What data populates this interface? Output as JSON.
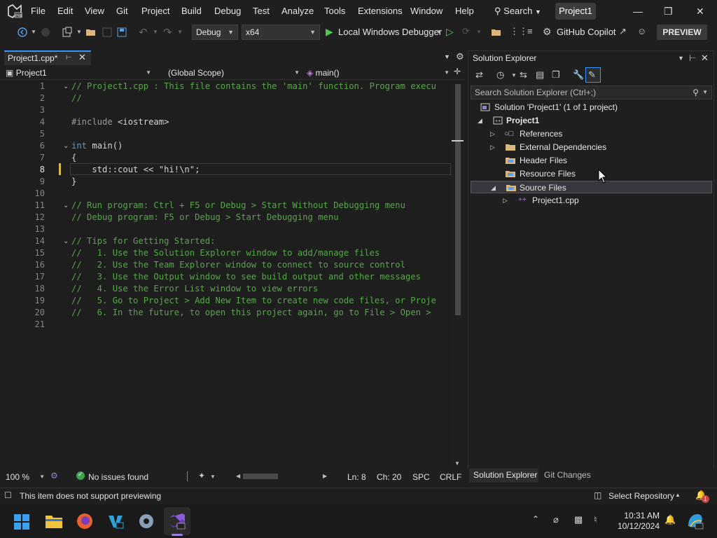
{
  "menu": {
    "items": [
      "File",
      "Edit",
      "View",
      "Git",
      "Project",
      "Build",
      "Debug",
      "Test",
      "Analyze",
      "Tools",
      "Extensions",
      "Window",
      "Help"
    ],
    "search_label": "Search",
    "project_badge": "Project1"
  },
  "toolbar": {
    "config": "Debug",
    "platform": "x64",
    "run_label": "Local Windows Debugger",
    "copilot_label": "GitHub Copilot",
    "preview_label": "PREVIEW"
  },
  "editor": {
    "tab_label": "Project1.cpp*",
    "nav": {
      "project": "Project1",
      "scope": "(Global Scope)",
      "member": "main()"
    },
    "current_line": 8,
    "lines": [
      {
        "n": "1",
        "text": "// Project1.cpp : This file contains the 'main' function. Program execu"
      },
      {
        "n": "2",
        "text": "//"
      },
      {
        "n": "3",
        "text": ""
      },
      {
        "n": "4",
        "pre": "#include ",
        "text": "<iostream>"
      },
      {
        "n": "5",
        "text": ""
      },
      {
        "n": "6",
        "pre": "int ",
        "text": "main()"
      },
      {
        "n": "7",
        "text": "{"
      },
      {
        "n": "8",
        "text": "    std::cout << \"hi!\\n\";"
      },
      {
        "n": "9",
        "text": "}"
      },
      {
        "n": "10",
        "text": ""
      },
      {
        "n": "11",
        "text": "// Run program: Ctrl + F5 or Debug > Start Without Debugging menu"
      },
      {
        "n": "12",
        "text": "// Debug program: F5 or Debug > Start Debugging menu"
      },
      {
        "n": "13",
        "text": ""
      },
      {
        "n": "14",
        "text": "// Tips for Getting Started:"
      },
      {
        "n": "15",
        "text": "//   1. Use the Solution Explorer window to add/manage files"
      },
      {
        "n": "16",
        "text": "//   2. Use the Team Explorer window to connect to source control"
      },
      {
        "n": "17",
        "text": "//   3. Use the Output window to see build output and other messages"
      },
      {
        "n": "18",
        "text": "//   4. Use the Error List window to view errors"
      },
      {
        "n": "19",
        "text": "//   5. Go to Project > Add New Item to create new code files, or Proje"
      },
      {
        "n": "20",
        "text": "//   6. In the future, to open this project again, go to File > Open >"
      },
      {
        "n": "21",
        "text": ""
      }
    ],
    "status": {
      "zoom": "100 %",
      "issues": "No issues found",
      "ln": "Ln: 8",
      "ch": "Ch: 20",
      "spc": "SPC",
      "crlf": "CRLF"
    }
  },
  "solution_explorer": {
    "title": "Solution Explorer",
    "search_placeholder": "Search Solution Explorer (Ctrl+;)",
    "tree": {
      "solution": "Solution 'Project1' (1 of 1 project)",
      "project": "Project1",
      "references": "References",
      "external": "External Dependencies",
      "headers": "Header Files",
      "resources": "Resource Files",
      "sources": "Source Files",
      "cpp": "Project1.cpp"
    },
    "tabs": [
      "Solution Explorer",
      "Git Changes"
    ]
  },
  "statusbar": {
    "message": "This item does not support previewing",
    "repo": "Select Repository",
    "notification_count": "1"
  },
  "taskbar": {
    "time": "10:31 AM",
    "date": "10/12/2024"
  },
  "colors": {
    "comment": "#57a64a",
    "keyword": "#569cd6",
    "accent": "#3794ff",
    "folder": "#dcb67a"
  }
}
